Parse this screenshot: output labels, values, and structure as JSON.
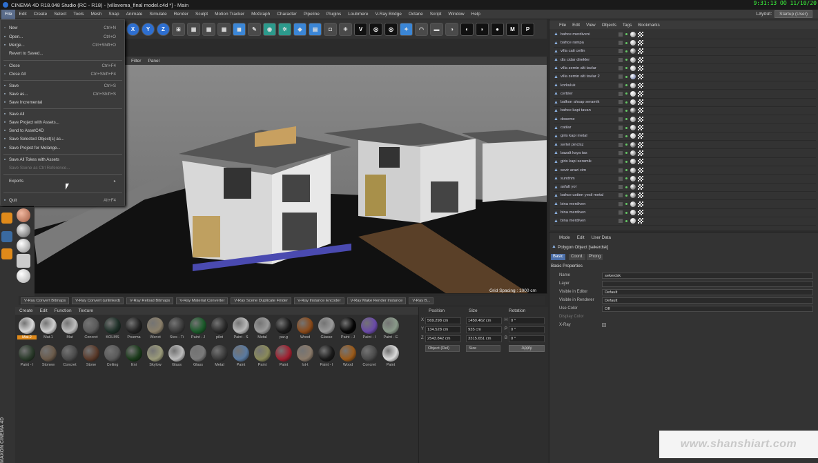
{
  "window": {
    "title": "CINEMA 4D R18.048 Studio (RC - R18) - [villavema_final model.c4d *] - Main",
    "clock": "9:31:13 ÖÖ 11/10/20"
  },
  "menubar": {
    "items": [
      "File",
      "Edit",
      "Create",
      "Select",
      "Tools",
      "Mesh",
      "Snap",
      "Animate",
      "Simulate",
      "Render",
      "Sculpt",
      "Motion Tracker",
      "MoGraph",
      "Character",
      "Pipeline",
      "Plugins",
      "Loubmere",
      "V-Ray Bridge",
      "Octane",
      "Script",
      "Window",
      "Help"
    ],
    "layout_label": "Layout:",
    "layout_value": "Startup (User)"
  },
  "filemenu": {
    "items": [
      {
        "label": "New",
        "shortcut": "Ctrl+N"
      },
      {
        "label": "Open...",
        "shortcut": "Ctrl+O"
      },
      {
        "label": "Merge...",
        "shortcut": "Ctrl+Shift+O"
      },
      {
        "label": "Revert to Saved...",
        "shortcut": ""
      },
      {
        "label": "Close",
        "shortcut": "Ctrl+F4"
      },
      {
        "label": "Close All",
        "shortcut": "Ctrl+Shift+F4"
      },
      {
        "label": "Save",
        "shortcut": "Ctrl+S"
      },
      {
        "label": "Save as...",
        "shortcut": "Ctrl+Shift+S"
      },
      {
        "label": "Save Incremental",
        "shortcut": ""
      },
      {
        "label": "Save All",
        "shortcut": ""
      },
      {
        "label": "Save Project with Assets...",
        "shortcut": ""
      },
      {
        "label": "Send to AssetC4D",
        "shortcut": ""
      },
      {
        "label": "Save Selected Object(s) as...",
        "shortcut": ""
      },
      {
        "label": "Save Project for Melange...",
        "shortcut": ""
      },
      {
        "label": "Save All Tokes with Assets",
        "shortcut": ""
      },
      {
        "label": "Save Scene as Ctrl Reference...",
        "shortcut": ""
      },
      {
        "label": "Exports",
        "shortcut": ""
      },
      {
        "label": "Quit",
        "shortcut": "Alt+F4"
      }
    ]
  },
  "viewport": {
    "menu": [
      "Filter",
      "Panel"
    ],
    "grid_label": "Grid Spacing : 1000 cm"
  },
  "vray_tabs": [
    "V-Ray Convert Bitmaps",
    "V-Ray Convert (unlinked)",
    "V-Ray Reload Bitmaps",
    "V-Ray Material Converter",
    "V-Ray Scene Duplicate Finder",
    "V-Ray Instance Encoder",
    "V-Ray Make Render Instance",
    "V-Ray B..."
  ],
  "materials": {
    "menu": [
      "Create",
      "Edit",
      "Function",
      "Texture"
    ],
    "row1": [
      {
        "label": "Mat.2",
        "color": "#d8d8d8",
        "sel": true
      },
      {
        "label": "Mat.1",
        "color": "#cfcfcf"
      },
      {
        "label": "Mat",
        "color": "#bdbdbd"
      },
      {
        "label": "Concret",
        "color": "#5a5a5a"
      },
      {
        "label": "KOLMS",
        "color": "#1e3028"
      },
      {
        "label": "Pourma",
        "color": "#222222"
      },
      {
        "label": "Wenxt",
        "color": "#8a7f6a"
      },
      {
        "label": "Stes - Ti",
        "color": "#3a3a3a"
      },
      {
        "label": "Paint - J",
        "color": "#1b5a2a"
      },
      {
        "label": "pilot",
        "color": "#2a2a2a"
      },
      {
        "label": "Paint - S",
        "color": "#b8b8b8"
      },
      {
        "label": "Metal",
        "color": "#9a9a9a"
      },
      {
        "label": "par.g",
        "color": "#1a1a1a"
      },
      {
        "label": "Wood",
        "color": "#8a4a1a"
      },
      {
        "label": "Glasse",
        "color": "#9a9a9a"
      },
      {
        "label": "Paint - J",
        "color": "#050505"
      },
      {
        "label": "Paint - I",
        "color": "#6a4aa8"
      },
      {
        "label": "Paint - E",
        "color": "#8a9a8a"
      }
    ],
    "row2": [
      {
        "label": "Paint - I",
        "color": "#2a3a2a"
      },
      {
        "label": "Stonew",
        "color": "#6a5a4a"
      },
      {
        "label": "Concret",
        "color": "#4a4a4a"
      },
      {
        "label": "Stone",
        "color": "#5a3a2a"
      },
      {
        "label": "Ceiling",
        "color": "#5a5a5a"
      },
      {
        "label": "Eni",
        "color": "#1a3a1a"
      },
      {
        "label": "Skylow",
        "color": "#9a9a7a"
      },
      {
        "label": "Glass",
        "color": "#bbbbbb"
      },
      {
        "label": "Glass",
        "color": "#7a7a7a"
      },
      {
        "label": "Metal",
        "color": "#3a3a3a"
      },
      {
        "label": "Paint",
        "color": "#5a7aa0"
      },
      {
        "label": "Paint",
        "color": "#8a8a5a"
      },
      {
        "label": "Paint",
        "color": "#a02030"
      },
      {
        "label": "Ist-t",
        "color": "#8a7a6a"
      },
      {
        "label": "Paint - I",
        "color": "#1a1a1a"
      },
      {
        "label": "Wood",
        "color": "#9a5a1a"
      },
      {
        "label": "Concret",
        "color": "#4a4a4a"
      },
      {
        "label": "Paint",
        "color": "#dadada"
      }
    ]
  },
  "coords": {
    "headers": [
      "Position",
      "Size",
      "Rotation"
    ],
    "rows": [
      {
        "axis": "X",
        "pos": "569.298 cm",
        "size": "1450.462 cm",
        "rot_axis": "H",
        "rot": "0 °"
      },
      {
        "axis": "Y",
        "pos": "134.528 cm",
        "size": "935 cm",
        "rot_axis": "P",
        "rot": "0 °"
      },
      {
        "axis": "Z",
        "pos": "2543.842 cm",
        "size": "3315.651 cm",
        "rot_axis": "B",
        "rot": "0 °"
      }
    ],
    "mode_dropdown": "Object (Rel)",
    "size_dropdown": "Size",
    "apply_label": "Apply"
  },
  "objects": {
    "menu": [
      "File",
      "Edit",
      "View",
      "Objects",
      "Tags",
      "Bookmarks"
    ],
    "rows": [
      {
        "name": "bahce merdiveni",
        "tag": "#777"
      },
      {
        "name": "bahce rampa",
        "tag": "#888"
      },
      {
        "name": "villa cati ceilin",
        "tag": "#333"
      },
      {
        "name": "dis cidar direkler",
        "tag": "#666"
      },
      {
        "name": "villa zemin alti tavlar",
        "tag": "#999"
      },
      {
        "name": "villa zemin alti tavlar 2",
        "tag": "#5a6aa0"
      },
      {
        "name": "korkuluk",
        "tag": "#777"
      },
      {
        "name": "cerbler",
        "tag": "#aaa"
      },
      {
        "name": "balkon ahsap seramik",
        "tag": "#888"
      },
      {
        "name": "bahce kapi tavan",
        "tag": "#111"
      },
      {
        "name": "doseme",
        "tag": "#666"
      },
      {
        "name": "catilar",
        "tag": "#777"
      },
      {
        "name": "giris kapi metal",
        "tag": "#999"
      },
      {
        "name": "sertel pinclsz",
        "tag": "#222"
      },
      {
        "name": "bazalt kaya tas",
        "tag": "#555"
      },
      {
        "name": "giris kapi seramik",
        "tag": "#777"
      },
      {
        "name": "sevir arazi cim",
        "tag": "#666"
      },
      {
        "name": "sundnm",
        "tag": "#777"
      },
      {
        "name": "asfalt yol",
        "tag": "#333"
      },
      {
        "name": "bahce ustten yesil metal",
        "tag": "#4a4a4a"
      },
      {
        "name": "bina merdiven",
        "tag": "#777"
      },
      {
        "name": "bina merdiven",
        "tag": "#888"
      },
      {
        "name": "bina merdiven",
        "tag": "#999"
      }
    ]
  },
  "attributes": {
    "menu": [
      "Mode",
      "Edit",
      "User Data"
    ],
    "object_title": "Polygon Object [sekerdsk]",
    "tabs": [
      "Basic",
      "Coord.",
      "Phong"
    ],
    "section": "Basic Properties",
    "fields": [
      {
        "label": "Name",
        "value": "sekerdsk"
      },
      {
        "label": "Layer",
        "value": ""
      },
      {
        "label": "Visible in Editor",
        "value": "Default"
      },
      {
        "label": "Visible in Renderer",
        "value": "Default"
      },
      {
        "label": "Use Color",
        "value": "Off"
      },
      {
        "label": "Display Color",
        "value": ""
      },
      {
        "label": "X-Ray",
        "value": ""
      }
    ]
  },
  "watermark": "www.shanshiart.com",
  "maxon_label": "MAXON CINEMA 4D"
}
